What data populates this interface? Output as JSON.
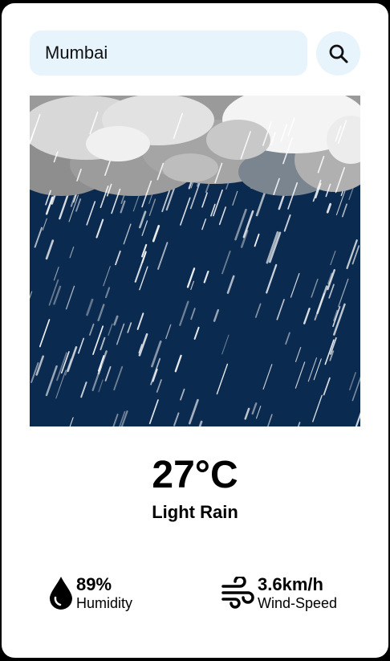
{
  "search": {
    "value": "Mumbai",
    "icon": "search-icon"
  },
  "weather": {
    "image_icon": "rain-icon",
    "temperature": "27°C",
    "condition": "Light Rain"
  },
  "stats": {
    "humidity": {
      "value": "89%",
      "label": "Humidity",
      "icon": "humidity-drop-icon"
    },
    "wind": {
      "value": "3.6km/h",
      "label": "Wind-Speed",
      "icon": "wind-icon"
    }
  },
  "colors": {
    "page_background": "#000000",
    "card_background": "#ffffff",
    "input_background": "#e7f4fc",
    "rain_sky": "#0b2a4f",
    "cloud_light": "#f2f2f2",
    "cloud_shadow": "#8c8c8c"
  }
}
